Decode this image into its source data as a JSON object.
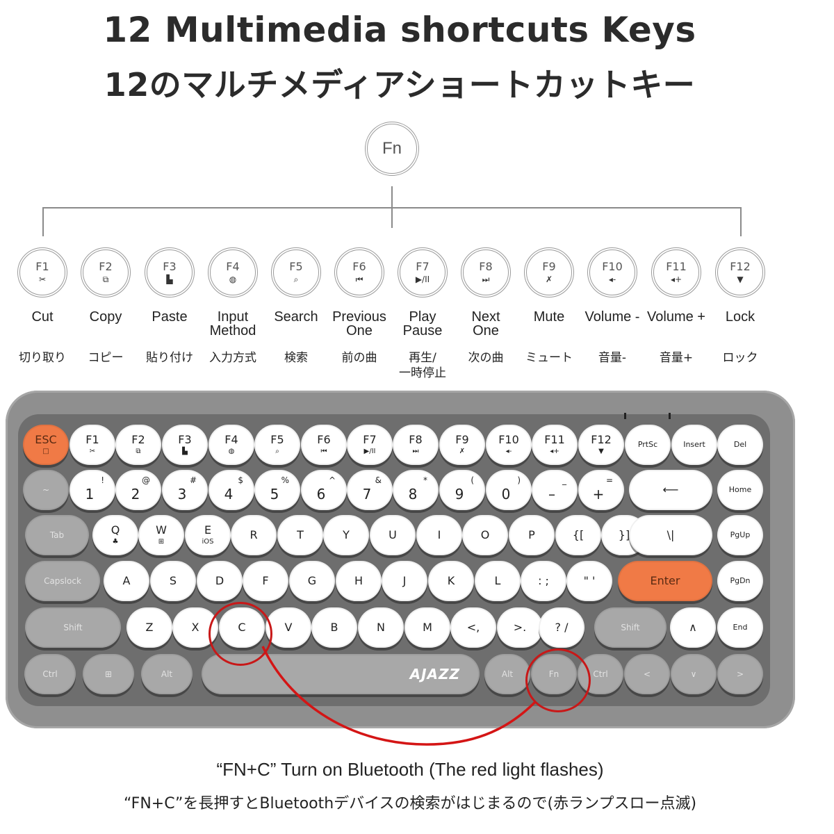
{
  "header": {
    "title_en": "12 Multimedia shortcuts Keys",
    "title_ja": "12のマルチメディアショートカットキー"
  },
  "diagram": {
    "root_key": "Fn",
    "function_keys": [
      {
        "key": "F1",
        "icon": "scissors-icon",
        "glyph": "✂",
        "label_en": "Cut",
        "label_ja": "切り取り"
      },
      {
        "key": "F2",
        "icon": "copy-icon",
        "glyph": "⧉",
        "label_en": "Copy",
        "label_ja": "コピー"
      },
      {
        "key": "F3",
        "icon": "paste-icon",
        "glyph": "▙",
        "label_en": "Paste",
        "label_ja": "貼り付け"
      },
      {
        "key": "F4",
        "icon": "globe-icon",
        "glyph": "◍",
        "label_en": "Input\nMethod",
        "label_ja": "入力方式"
      },
      {
        "key": "F5",
        "icon": "search-icon",
        "glyph": "⌕",
        "label_en": "Search",
        "label_ja": "検索"
      },
      {
        "key": "F6",
        "icon": "previous-track-icon",
        "glyph": "⏮",
        "label_en": "Previous\nOne",
        "label_ja": "前の曲"
      },
      {
        "key": "F7",
        "icon": "play-pause-icon",
        "glyph": "▶/II",
        "label_en": "Play\nPause",
        "label_ja": "再生/\n一時停止"
      },
      {
        "key": "F8",
        "icon": "next-track-icon",
        "glyph": "⏭",
        "label_en": "Next\nOne",
        "label_ja": "次の曲"
      },
      {
        "key": "F9",
        "icon": "mute-icon",
        "glyph": "✗",
        "label_en": "Mute",
        "label_ja": "ミュート"
      },
      {
        "key": "F10",
        "icon": "volume-down-icon",
        "glyph": "◂-",
        "label_en": "Volume -",
        "label_ja": "音量-"
      },
      {
        "key": "F11",
        "icon": "volume-up-icon",
        "glyph": "◂+",
        "label_en": "Volume +",
        "label_ja": "音量+"
      },
      {
        "key": "F12",
        "icon": "lock-screen-icon",
        "glyph": "▼",
        "label_en": "Lock",
        "label_ja": "ロック"
      }
    ]
  },
  "keyboard": {
    "brand": "AJAZZ",
    "colors": {
      "body": "#8f8f8f",
      "plate": "#6e6e6e",
      "white_key": "#ffffff",
      "grey_key": "#a8a8a8",
      "accent_key": "#f07a46",
      "highlight": "#c81818"
    },
    "rows": [
      [
        {
          "main": "ESC",
          "sub": "□",
          "style": "orange"
        },
        {
          "main": "F1",
          "sub": "✂"
        },
        {
          "main": "F2",
          "sub": "⧉"
        },
        {
          "main": "F3",
          "sub": "▙"
        },
        {
          "main": "F4",
          "sub": "◍"
        },
        {
          "main": "F5",
          "sub": "⌕"
        },
        {
          "main": "F6",
          "sub": "⏮"
        },
        {
          "main": "F7",
          "sub": "▶/II"
        },
        {
          "main": "F8",
          "sub": "⏭"
        },
        {
          "main": "F9",
          "sub": "✗"
        },
        {
          "main": "F10",
          "sub": "◂-"
        },
        {
          "main": "F11",
          "sub": "◂+"
        },
        {
          "main": "F12",
          "sub": "▼"
        },
        {
          "main": "PrtSc",
          "style": "small"
        },
        {
          "main": "Insert",
          "style": "small"
        },
        {
          "main": "Del",
          "style": "small"
        }
      ],
      [
        {
          "main": "~",
          "style": "grey"
        },
        {
          "main": "1",
          "shift": "!"
        },
        {
          "main": "2",
          "shift": "@"
        },
        {
          "main": "3",
          "shift": "#"
        },
        {
          "main": "4",
          "shift": "$"
        },
        {
          "main": "5",
          "shift": "%"
        },
        {
          "main": "6",
          "shift": "^"
        },
        {
          "main": "7",
          "shift": "&"
        },
        {
          "main": "8",
          "shift": "*"
        },
        {
          "main": "9",
          "shift": "("
        },
        {
          "main": "0",
          "shift": ")"
        },
        {
          "main": "–",
          "shift": "_"
        },
        {
          "main": "+",
          "shift": "="
        },
        {
          "main": "⟵",
          "style": "wide"
        },
        {
          "main": "Home",
          "style": "small"
        }
      ],
      [
        {
          "main": "Tab",
          "style": "grey"
        },
        {
          "main": "Q",
          "sub": "♣"
        },
        {
          "main": "W",
          "sub": "⊞"
        },
        {
          "main": "E",
          "sub": "iOS"
        },
        {
          "main": "R"
        },
        {
          "main": "T"
        },
        {
          "main": "Y"
        },
        {
          "main": "U"
        },
        {
          "main": "I"
        },
        {
          "main": "O"
        },
        {
          "main": "P"
        },
        {
          "main": "{["
        },
        {
          "main": "}]"
        },
        {
          "main": "\\|"
        },
        {
          "main": "PgUp",
          "style": "small"
        }
      ],
      [
        {
          "main": "Capslock",
          "style": "grey"
        },
        {
          "main": "A"
        },
        {
          "main": "S"
        },
        {
          "main": "D"
        },
        {
          "main": "F"
        },
        {
          "main": "G"
        },
        {
          "main": "H"
        },
        {
          "main": "J"
        },
        {
          "main": "K"
        },
        {
          "main": "L"
        },
        {
          "main": ": ;"
        },
        {
          "main": "\" '"
        },
        {
          "main": "Enter",
          "style": "orange"
        },
        {
          "main": "PgDn",
          "style": "small"
        }
      ],
      [
        {
          "main": "Shift",
          "style": "grey"
        },
        {
          "main": "Z"
        },
        {
          "main": "X"
        },
        {
          "main": "C"
        },
        {
          "main": "V"
        },
        {
          "main": "B"
        },
        {
          "main": "N"
        },
        {
          "main": "M"
        },
        {
          "main": "<,"
        },
        {
          "main": ">."
        },
        {
          "main": "? /"
        },
        {
          "main": "Shift",
          "style": "grey"
        },
        {
          "main": "∧"
        },
        {
          "main": "End",
          "style": "small"
        }
      ],
      [
        {
          "main": "Ctrl",
          "style": "grey"
        },
        {
          "main": "⊞",
          "style": "grey"
        },
        {
          "main": "Alt",
          "style": "grey"
        },
        {
          "main": "",
          "style": "grey"
        },
        {
          "main": "Alt",
          "style": "grey"
        },
        {
          "main": "Fn",
          "style": "grey"
        },
        {
          "main": "Ctrl",
          "style": "grey"
        },
        {
          "main": "<",
          "style": "grey"
        },
        {
          "main": "∨",
          "style": "grey"
        },
        {
          "main": ">",
          "style": "grey"
        }
      ]
    ],
    "highlighted_keys": [
      "C",
      "Fn"
    ]
  },
  "captions": {
    "en": "“FN+C” Turn on Bluetooth (The red light flashes)",
    "ja": "“FN+C”を長押すとBluetoothデバイスの検索がはじまるので(赤ランプスロー点滅)"
  }
}
